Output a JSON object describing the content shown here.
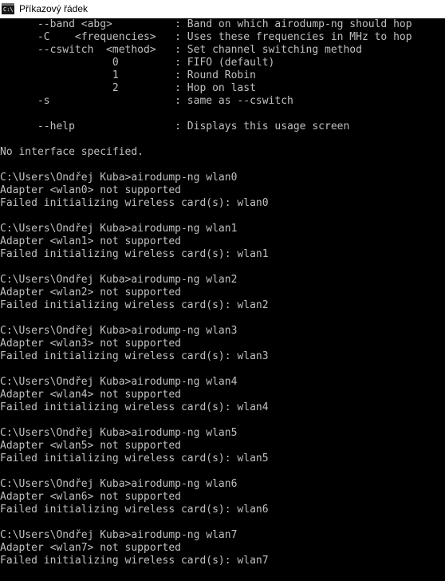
{
  "window": {
    "title": "Příkazový řádek",
    "icon": "console-icon",
    "icon_text": "C:\\"
  },
  "colors": {
    "background": "#000000",
    "text": "#c0c0c0",
    "titlebar": "#ffffff"
  },
  "console": {
    "lines": [
      "      --band <abg>          : Band on which airodump-ng should hop",
      "      -C    <frequencies>   : Uses these frequencies in MHz to hop",
      "      --cswitch  <method>   : Set channel switching method",
      "                  0         : FIFO (default)",
      "                  1         : Round Robin",
      "                  2         : Hop on last",
      "      -s                    : same as --cswitch",
      "",
      "      --help                : Displays this usage screen",
      "",
      "No interface specified.",
      "",
      "C:\\Users\\Ondřej Kuba>airodump-ng wlan0",
      "Adapter <wlan0> not supported",
      "Failed initializing wireless card(s): wlan0",
      "",
      "C:\\Users\\Ondřej Kuba>airodump-ng wlan1",
      "Adapter <wlan1> not supported",
      "Failed initializing wireless card(s): wlan1",
      "",
      "C:\\Users\\Ondřej Kuba>airodump-ng wlan2",
      "Adapter <wlan2> not supported",
      "Failed initializing wireless card(s): wlan2",
      "",
      "C:\\Users\\Ondřej Kuba>airodump-ng wlan3",
      "Adapter <wlan3> not supported",
      "Failed initializing wireless card(s): wlan3",
      "",
      "C:\\Users\\Ondřej Kuba>airodump-ng wlan4",
      "Adapter <wlan4> not supported",
      "Failed initializing wireless card(s): wlan4",
      "",
      "C:\\Users\\Ondřej Kuba>airodump-ng wlan5",
      "Adapter <wlan5> not supported",
      "Failed initializing wireless card(s): wlan5",
      "",
      "C:\\Users\\Ondřej Kuba>airodump-ng wlan6",
      "Adapter <wlan6> not supported",
      "Failed initializing wireless card(s): wlan6",
      "",
      "C:\\Users\\Ondřej Kuba>airodump-ng wlan7",
      "Adapter <wlan7> not supported",
      "Failed initializing wireless card(s): wlan7"
    ]
  }
}
